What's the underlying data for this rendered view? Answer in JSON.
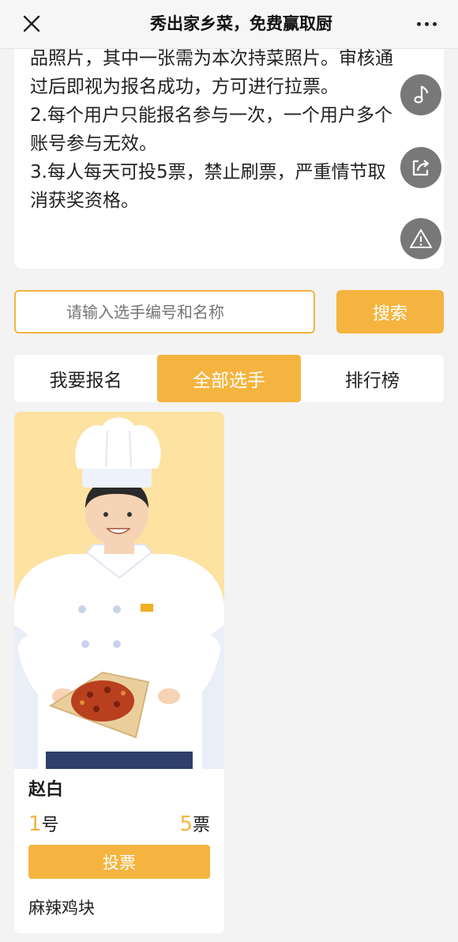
{
  "topbar": {
    "title": "秀出家乡菜，免费赢取厨",
    "close_icon": "close-icon",
    "more_icon": "more-icon"
  },
  "rules": {
    "lines": [
      "品照片，其中一张需为本次持菜照片。审核通",
      "过后即视为报名成功，方可进行拉票。",
      "2.每个用户只能报名参与一次，一个用户多个",
      "账号参与无效。",
      "3.每人每天可投5票，禁止刷票，严重情节取",
      "消获奖资格。"
    ]
  },
  "float_buttons": [
    "music-icon",
    "share-icon",
    "warning-icon"
  ],
  "search": {
    "placeholder": "请输入选手编号和名称",
    "button_label": "搜索"
  },
  "tabs": [
    {
      "label": "我要报名",
      "active": false
    },
    {
      "label": "全部选手",
      "active": true
    },
    {
      "label": "排行榜",
      "active": false
    }
  ],
  "player": {
    "name": "赵白",
    "number": "1",
    "number_suffix": "号",
    "votes": "5",
    "votes_suffix": "票",
    "vote_button_label": "投票",
    "dish": "麻辣鸡块"
  },
  "colors": {
    "accent": "#f5b43f",
    "background": "#f3f3f3",
    "photo_bg": "#fde2a2"
  }
}
